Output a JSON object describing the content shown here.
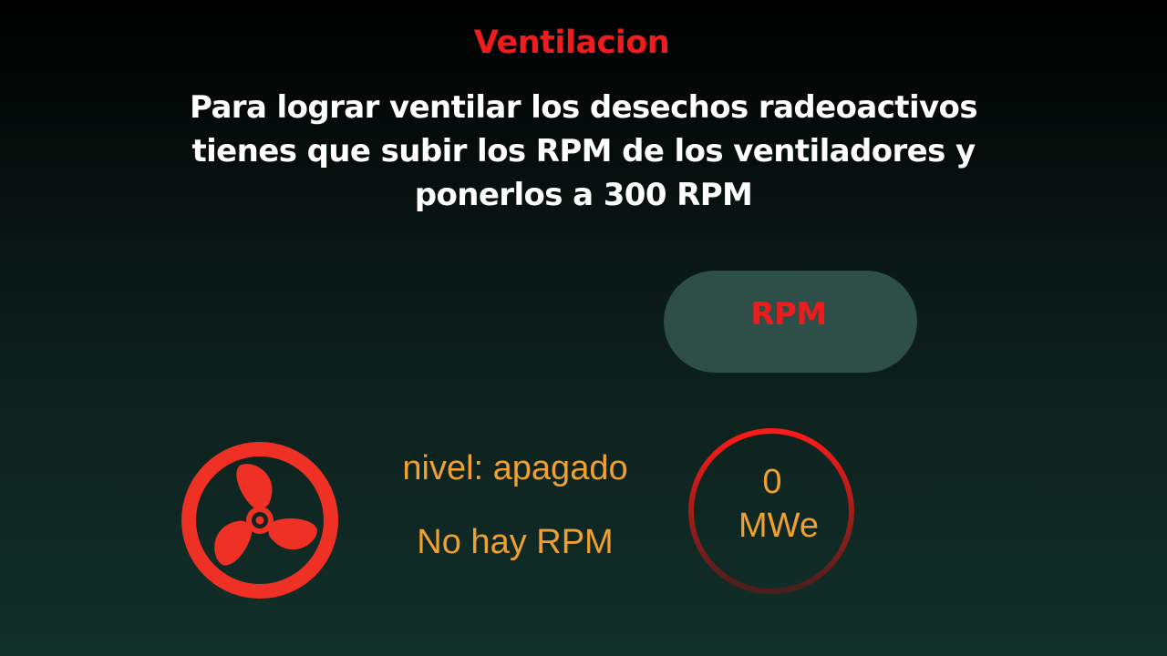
{
  "header": {
    "title": "Ventilacion",
    "instructions": "Para lograr ventilar los desechos radeoactivos  tienes que subir los RPM de los ventiladores y ponerlos a 300 RPM"
  },
  "controls": {
    "rpm_button_label": "RPM"
  },
  "status": {
    "level_text": "nivel: apagado",
    "rpm_text": "No hay RPM"
  },
  "gauge": {
    "value": "0",
    "unit": "MWe"
  },
  "icons": {
    "fan": "fan-icon"
  },
  "colors": {
    "accent_red": "#ee1c1c",
    "status_orange": "#f0a030",
    "button_bg": "#2e4e48",
    "fan_red": "#ee3124"
  }
}
